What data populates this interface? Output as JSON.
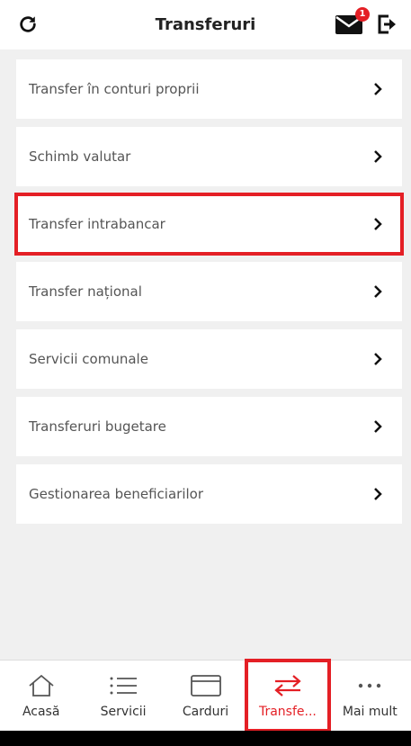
{
  "header": {
    "title": "Transferuri",
    "badge_count": "1"
  },
  "menu": {
    "items": [
      {
        "label": "Transfer în conturi proprii"
      },
      {
        "label": "Schimb valutar"
      },
      {
        "label": "Transfer intrabancar"
      },
      {
        "label": "Transfer național"
      },
      {
        "label": "Servicii comunale"
      },
      {
        "label": "Transferuri bugetare"
      },
      {
        "label": "Gestionarea beneficiarilor"
      }
    ]
  },
  "bottom_nav": {
    "items": [
      {
        "label": "Acasă"
      },
      {
        "label": "Servicii"
      },
      {
        "label": "Carduri"
      },
      {
        "label": "Transfe..."
      },
      {
        "label": "Mai mult"
      }
    ]
  },
  "colors": {
    "accent": "#e41f25",
    "background": "#f0f0f0"
  }
}
